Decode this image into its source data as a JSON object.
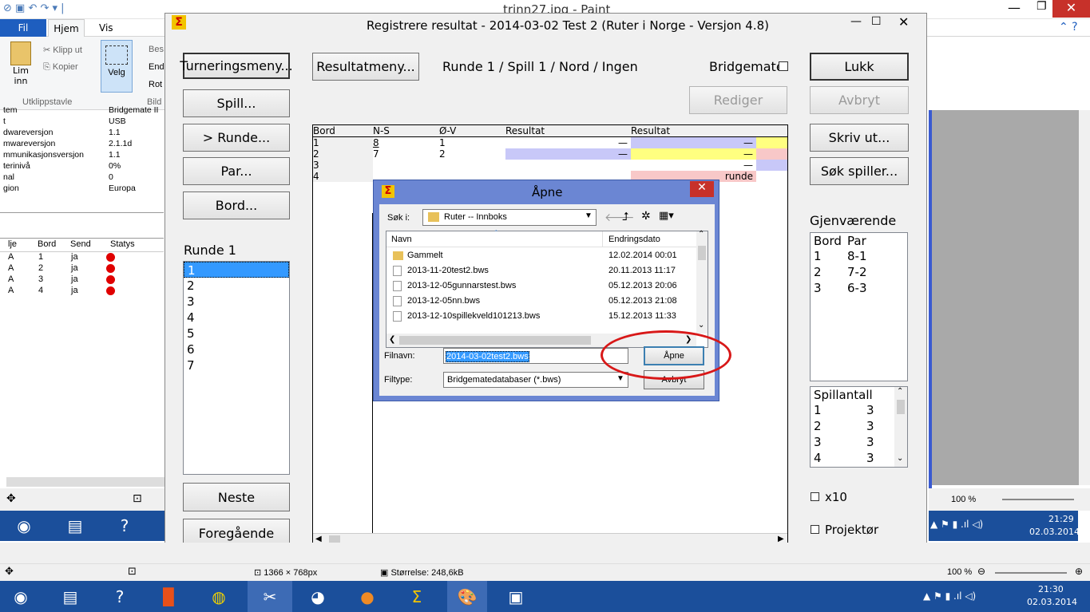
{
  "paint": {
    "title": "trinn27.jpg - Paint",
    "tabs": [
      "Fil",
      "Hjem",
      "Vis"
    ],
    "clipboard": {
      "paste": "Lim inn",
      "cut": "Klipp ut",
      "copy": "Kopier",
      "group": "Utklippstavle",
      "select": "Velg",
      "crop_partial": "Bes",
      "resize_partial": "End",
      "rotate_partial": "Rot",
      "image_partial": "Bild"
    },
    "props": [
      [
        "tem",
        "Bridgemate II"
      ],
      [
        "t",
        "USB"
      ],
      [
        "dwareversjon",
        "1.1"
      ],
      [
        "mwareversjon",
        "2.1.1d"
      ],
      [
        "mmunikasjonsversjon",
        "1.1"
      ],
      [
        "terinivå",
        "0%"
      ],
      [
        "nal",
        "0"
      ],
      [
        "gion",
        "Europa"
      ]
    ],
    "list_headers": [
      "lje",
      "Bord",
      "Send",
      "Statys"
    ],
    "list_rows": [
      [
        "A",
        "1",
        "ja"
      ],
      [
        "A",
        "2",
        "ja"
      ],
      [
        "A",
        "3",
        "ja"
      ],
      [
        "A",
        "4",
        "ja"
      ]
    ],
    "status_size": "1366 × 768px",
    "status_filesize": "Størrelse: 248,6kB",
    "zoom": "100 %",
    "zoom_inner": "100 %"
  },
  "ruter": {
    "title": "Registrere resultat - 2014-03-02  Test 2  (Ruter i Norge - Versjon 4.8)",
    "left_buttons": [
      "Turneringsmeny...",
      "Spill...",
      ">  Runde...",
      "Par...",
      "Bord..."
    ],
    "round_label": "Runde 1",
    "rounds": [
      "1",
      "2",
      "3",
      "4",
      "5",
      "6",
      "7"
    ],
    "next": "Neste",
    "prev": "Foregående",
    "result_menu": "Resultatmeny...",
    "status_line": "Runde 1 / Spill 1 / Nord / Ingen",
    "bridgemate": "Bridgemate",
    "edit": "Rediger",
    "right_buttons": {
      "close": "Lukk",
      "cancel": "Avbryt",
      "print": "Skriv ut...",
      "search": "Søk spiller..."
    },
    "grid_headers": [
      "Bord",
      "N-S",
      "Ø-V",
      "Resultat",
      "Resultat"
    ],
    "grid_rows": [
      [
        "1",
        "8",
        "1",
        "—",
        "—"
      ],
      [
        "2",
        "7",
        "2",
        "—",
        "—"
      ],
      [
        "3",
        "",
        "",
        "",
        "—"
      ],
      [
        "4",
        "",
        "",
        "",
        "runde"
      ]
    ],
    "remaining_label": "Gjenværende",
    "remaining_headers": [
      "Bord",
      "Par"
    ],
    "remaining_rows": [
      [
        "1",
        "8-1"
      ],
      [
        "2",
        "7-2"
      ],
      [
        "3",
        "6-3"
      ]
    ],
    "games_header": "Spillantall",
    "games_rows": [
      [
        "1",
        "3"
      ],
      [
        "2",
        "3"
      ],
      [
        "3",
        "3"
      ],
      [
        "4",
        "3"
      ]
    ],
    "x10": "x10",
    "projector": "Projektør"
  },
  "dialog": {
    "title": "Åpne",
    "lookin_label": "Søk i:",
    "lookin_value": "Ruter -- Innboks",
    "col_name": "Navn",
    "col_date": "Endringsdato",
    "files": [
      [
        "Gammelt",
        "12.02.2014 00:01"
      ],
      [
        "2013-11-20test2.bws",
        "20.11.2013 11:17"
      ],
      [
        "2013-12-05gunnarstest.bws",
        "05.12.2013 20:06"
      ],
      [
        "2013-12-05nn.bws",
        "05.12.2013 21:08"
      ],
      [
        "2013-12-10spillekveld101213.bws",
        "15.12.2013 11:33"
      ]
    ],
    "filename_label": "Filnavn:",
    "filename_value": "2014-03-02test2.bws",
    "filetype_label": "Filtype:",
    "filetype_value": "Bridgematedatabaser (*.bws)",
    "open": "Åpne",
    "cancel": "Avbryt"
  },
  "taskbar": {
    "time_inner": "21:29",
    "date_inner": "02.03.2014",
    "time": "21:30",
    "date": "02.03.2014"
  },
  "colors": {
    "taskbar": "#1b4f9b",
    "selection": "#3399ff",
    "lilac": "#c8c8f8",
    "yellow": "#ffff80",
    "pink": "#f8c8c8",
    "circle": "#d81818"
  }
}
